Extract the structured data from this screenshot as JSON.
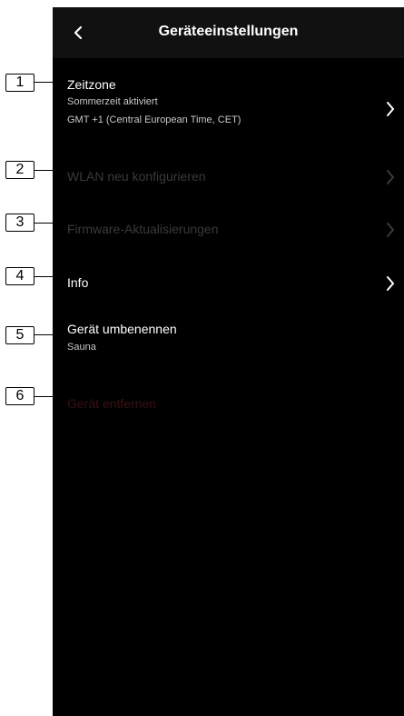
{
  "header": {
    "title": "Geräteeinstellungen"
  },
  "rows": [
    {
      "title": "Zeitzone",
      "sub1": "Sommerzeit aktiviert",
      "sub2": "GMT +1 (Central European Time, CET)"
    },
    {
      "title": "WLAN neu konfigurieren"
    },
    {
      "title": "Firmware-Aktualisierungen"
    },
    {
      "title": "Info"
    },
    {
      "title": "Gerät umbenennen",
      "sub1": "Sauna"
    },
    {
      "title": "Gerät entfernen"
    }
  ],
  "callouts": [
    "1",
    "2",
    "3",
    "4",
    "5",
    "6"
  ]
}
